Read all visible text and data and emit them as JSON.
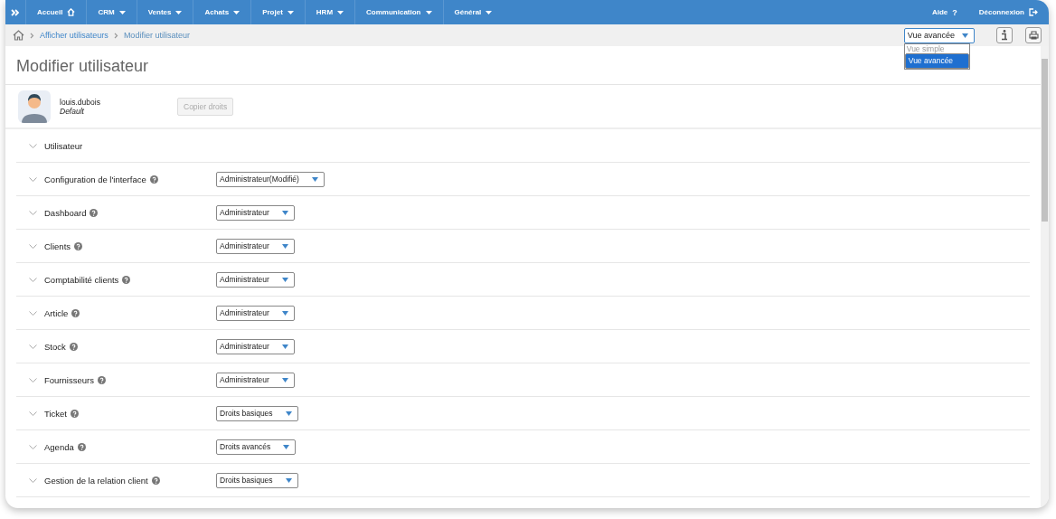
{
  "nav": {
    "items": [
      {
        "label": "Accueil",
        "kind": "home"
      },
      {
        "label": "CRM",
        "kind": "menu"
      },
      {
        "label": "Ventes",
        "kind": "menu"
      },
      {
        "label": "Achats",
        "kind": "menu"
      },
      {
        "label": "Projet",
        "kind": "menu"
      },
      {
        "label": "HRM",
        "kind": "menu"
      },
      {
        "label": "Communication",
        "kind": "menu"
      },
      {
        "label": "Général",
        "kind": "menu"
      }
    ],
    "help": {
      "label": "Aide",
      "glyph": "?"
    },
    "logout": {
      "label": "Déconnexion"
    }
  },
  "breadcrumb": [
    {
      "label": "Afficher utilisateurs",
      "current": false
    },
    {
      "label": "Modifier utilisateur",
      "current": true
    }
  ],
  "view_select": {
    "value": "Vue avancée",
    "options": [
      {
        "label": "Vue simple",
        "selected": false
      },
      {
        "label": "Vue avancée",
        "selected": true
      }
    ]
  },
  "title": "Modifier utilisateur",
  "user": {
    "login": "louis.dubois",
    "profile": "Default"
  },
  "copy_button": {
    "label": "Copier droits",
    "disabled": true
  },
  "sections": [
    {
      "label": "Utilisateur",
      "help": false
    },
    {
      "label": "Configuration de l'interface",
      "help": true,
      "value": "Administrateur(Modifié)"
    },
    {
      "label": "Dashboard",
      "help": true,
      "value": "Administrateur"
    },
    {
      "label": "Clients",
      "help": true,
      "value": "Administrateur"
    },
    {
      "label": "Comptabilité clients",
      "help": true,
      "value": "Administrateur"
    },
    {
      "label": "Article",
      "help": true,
      "value": "Administrateur"
    },
    {
      "label": "Stock",
      "help": true,
      "value": "Administrateur"
    },
    {
      "label": "Fournisseurs",
      "help": true,
      "value": "Administrateur"
    },
    {
      "label": "Ticket",
      "help": true,
      "value": "Droits basiques"
    },
    {
      "label": "Agenda",
      "help": true,
      "value": "Droits avancés"
    },
    {
      "label": "Gestion de la relation client",
      "help": true,
      "value": "Droits basiques"
    }
  ]
}
